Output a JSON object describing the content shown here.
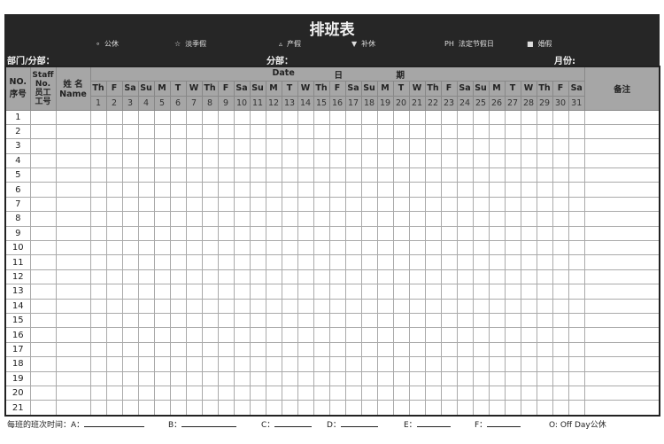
{
  "header": {
    "title": "排班表",
    "dept_label": "部门/分部：",
    "branch_label": "分部：",
    "month_label": "月份:"
  },
  "legend": [
    {
      "symbol": "∘",
      "label": "公休"
    },
    {
      "symbol": "☆",
      "label": "淡季假"
    },
    {
      "symbol": "▵",
      "label": "产假"
    },
    {
      "symbol": "▼",
      "label": "补休"
    },
    {
      "symbol": "PH",
      "label": "法定节假日"
    },
    {
      "symbol": "■",
      "label": "婚假"
    }
  ],
  "table": {
    "col_no": [
      "NO.",
      "序号"
    ],
    "col_staff": [
      "Staff",
      "No.",
      "员工",
      "工号"
    ],
    "col_name": [
      "姓 名",
      "Name"
    ],
    "date_label": [
      "Date",
      "日",
      "期"
    ],
    "remark": "备注",
    "weekdays": [
      "Th",
      "F",
      "Sa",
      "Su",
      "M",
      "T",
      "W",
      "Th",
      "F",
      "Sa",
      "Su",
      "M",
      "T",
      "W",
      "Th",
      "F",
      "Sa",
      "Su",
      "M",
      "T",
      "W",
      "Th",
      "F",
      "Sa",
      "Su",
      "M",
      "T",
      "W",
      "Th",
      "F",
      "Sa"
    ],
    "days": [
      "1",
      "2",
      "3",
      "4",
      "5",
      "6",
      "7",
      "8",
      "9",
      "10",
      "11",
      "12",
      "13",
      "14",
      "15",
      "16",
      "17",
      "18",
      "19",
      "20",
      "21",
      "22",
      "23",
      "24",
      "25",
      "26",
      "27",
      "28",
      "29",
      "30",
      "31"
    ],
    "rows": [
      "1",
      "2",
      "3",
      "4",
      "5",
      "6",
      "7",
      "8",
      "9",
      "10",
      "11",
      "12",
      "13",
      "14",
      "15",
      "16",
      "17",
      "18",
      "19",
      "20",
      "21"
    ]
  },
  "footer": {
    "shift_label": "每班的班次时间：A：",
    "b": "B：",
    "c": "C：",
    "d": "D：",
    "e": "E：",
    "f": "F：",
    "off": "O: Off Day公休"
  }
}
